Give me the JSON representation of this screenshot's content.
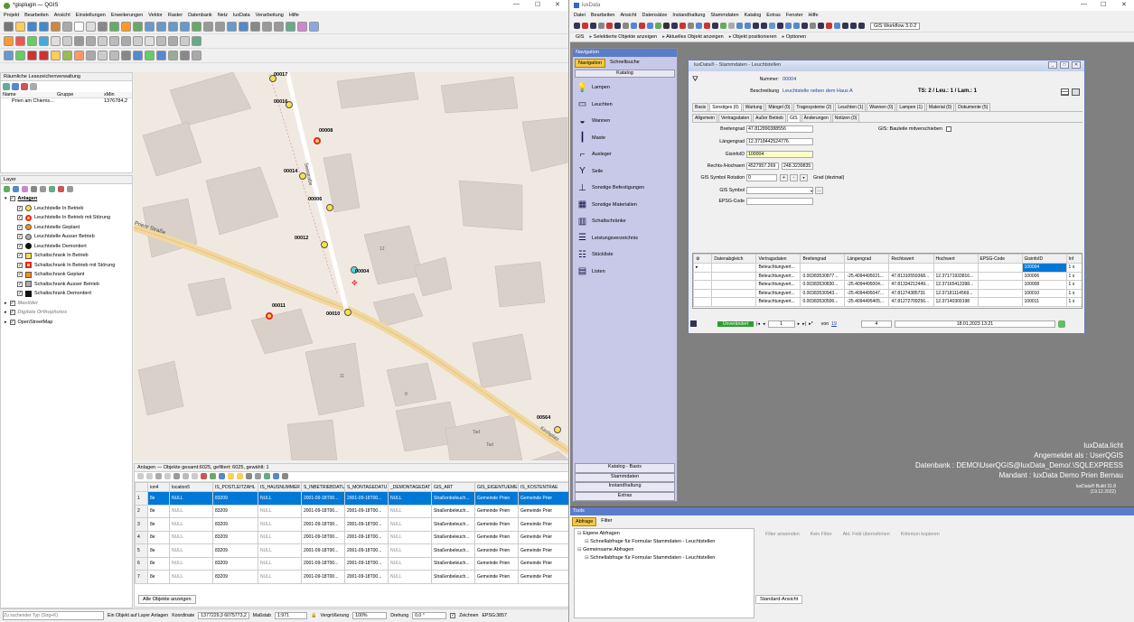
{
  "qgis": {
    "title": "*gisplugin — QGIS",
    "menu": [
      "Projekt",
      "Bearbeiten",
      "Ansicht",
      "Einstellungen",
      "Erweiterungen",
      "Vektor",
      "Raster",
      "Datenbank",
      "Netz",
      "luxData",
      "Verarbeitung",
      "Hilfe"
    ],
    "bookmarks": {
      "title": "Räumliche Lesezeichenverwaltung",
      "cols": [
        "Name",
        "Gruppe",
        "xMin"
      ],
      "row": {
        "name": "Prien am Chiems...",
        "group": "",
        "xmin": "1376784,2"
      }
    },
    "layers_title": "Layer",
    "layers": [
      {
        "label": "Anlagen",
        "group": true
      },
      {
        "label": "Leuchtstelle In Betrieb",
        "sym": "yellow-circle"
      },
      {
        "label": "Leuchtstelle In Betrieb mit Störung",
        "sym": "red-ring"
      },
      {
        "label": "Leuchtstelle Geplant",
        "sym": "orange-circle"
      },
      {
        "label": "Leuchtstelle Ausser Betrieb",
        "sym": "gray-circle"
      },
      {
        "label": "Leuchtstelle Demontiert",
        "sym": "black-circle"
      },
      {
        "label": "Schaltschrank In Betrieb",
        "sym": "yellow-square"
      },
      {
        "label": "Schaltschrank In Betrieb mit Störung",
        "sym": "red-square"
      },
      {
        "label": "Schaltschrank Geplant",
        "sym": "orange-square"
      },
      {
        "label": "Schaltschrank Ausser Betrieb",
        "sym": "gray-square"
      },
      {
        "label": "Schaltschrank Demontiert",
        "sym": "black-square"
      },
      {
        "label": "Mastlder",
        "group": true,
        "italic": true
      },
      {
        "label": "Digitale Orthophotos",
        "group": true,
        "italic": true
      },
      {
        "label": "OpenStreetMap",
        "group": true
      }
    ],
    "map_labels": [
      {
        "text": "00017"
      },
      {
        "text": "00016"
      },
      {
        "text": "00008"
      },
      {
        "text": "00014"
      },
      {
        "text": "00006"
      },
      {
        "text": "00012"
      },
      {
        "text": "00004"
      },
      {
        "text": "00011"
      },
      {
        "text": "00010"
      },
      {
        "text": "00564"
      }
    ],
    "street_labels": [
      "Prienr Straße",
      "Seestraße",
      "Kirchplatz"
    ],
    "house_numbers": [
      "12",
      "11",
      "9",
      "Tad",
      "Tad"
    ],
    "attr": {
      "title": "Anlagen — Objekte gesamt:6025, gefiltert: 6025, gewählt: 1",
      "cols": [
        "ion4",
        "location5",
        "IS_POSTLEITZAHL",
        "IS_HAUSNUMMER",
        "S_INBETRIEBDATU",
        "S_MONTAGEDATU",
        "_DEMONTAGEDAT",
        "GIS_ART",
        "GIS_EIGENTUEMER",
        "IS_KOSTENTRAE"
      ],
      "rows": [
        [
          "1",
          "8e",
          "NULL",
          "83209",
          "NULL",
          "2001-09-18T00...",
          "2001-09-18T00...",
          "NULL",
          "Straßenbeleuch...",
          "Gemeinde Prien",
          "Gemeinde Prier"
        ],
        [
          "2",
          "8e",
          "NULL",
          "83209",
          "NULL",
          "2001-09-18T00...",
          "2001-09-18T00...",
          "NULL",
          "Straßenbeleuch...",
          "Gemeinde Prien",
          "Gemeinde Prier"
        ],
        [
          "3",
          "8e",
          "NULL",
          "83209",
          "NULL",
          "2001-09-18T00...",
          "2001-09-18T00...",
          "NULL",
          "Straßenbeleuch...",
          "Gemeinde Prien",
          "Gemeinde Prier"
        ],
        [
          "4",
          "8e",
          "NULL",
          "83209",
          "NULL",
          "2001-09-18T00...",
          "2001-09-18T00...",
          "NULL",
          "Straßenbeleuch...",
          "Gemeinde Prien",
          "Gemeinde Prier"
        ],
        [
          "5",
          "8e",
          "NULL",
          "83209",
          "NULL",
          "2001-09-18T00...",
          "2001-09-18T00...",
          "NULL",
          "Straßenbeleuch...",
          "Gemeinde Prien",
          "Gemeinde Prier"
        ],
        [
          "6",
          "8e",
          "NULL",
          "83209",
          "NULL",
          "2001-09-18T00...",
          "2001-09-18T00...",
          "NULL",
          "Straßenbeleuch...",
          "Gemeinde Prien",
          "Gemeinde Prier"
        ],
        [
          "7",
          "8e",
          "NULL",
          "83209",
          "NULL",
          "2001-09-18T00...",
          "2001-09-18T00...",
          "NULL",
          "Straßenbeleuch...",
          "Gemeinde Prien",
          "Gemeinde Prier"
        ]
      ],
      "show_all": "Alle Objekte anzeigen"
    },
    "status": {
      "search_placeholder": "Zu suchender Typ (Strg+K)",
      "msg": "Ein Objekt auf Layer Anlagen",
      "coord_label": "Koordinate",
      "coord": "1377229,3 6075773,2",
      "scale_label": "Maßstab",
      "scale": "1:971",
      "magnifier_label": "Vergrößerung",
      "magnifier": "100%",
      "rotation_label": "Drehung",
      "rotation": "0,0 °",
      "render_label": "Zeichnen",
      "crs": "EPSG:3857"
    }
  },
  "lux": {
    "title": "luxData",
    "menu": [
      "Datei",
      "Bearbeiten",
      "Ansicht",
      "Datensätze",
      "Instandhaltung",
      "Stammdaten",
      "Katalog",
      "Extras",
      "Fenster",
      "Hilfe"
    ],
    "gis_workflow": "GIS Workflow 3.0.2",
    "gisbar": [
      "GIS",
      "Selektierte Objekte anzeigen",
      "Aktuelles Objekt anzeigen",
      "Objekt positionieren",
      "Optionen"
    ],
    "nav": {
      "title": "Navigation",
      "tabs": [
        "Navigation",
        "Schnellsuche"
      ],
      "katalog": "Katalog",
      "items": [
        "Lampen",
        "Leuchten",
        "Wannen",
        "Maste",
        "Ausleger",
        "Seile",
        "Sonstige Befestigungen",
        "Sonstige Materialien",
        "Schaltschränke",
        "Leistungsverzeichnis",
        "Stückliste",
        "Listen"
      ],
      "bottom": [
        "Katalog - Basis",
        "Stammdaten",
        "Instandhaltung",
        "Extras"
      ]
    },
    "form": {
      "title": "luxData® - Stammdaten - Leuchtstellen",
      "nummer_label": "Nummer:",
      "nummer": "00004",
      "beschreibung_label": "Beschreibung",
      "beschreibung": "Leuchtstelle neben dem Haus A",
      "ts": "TS: 2 / Leu.: 1 / Lam.: 1",
      "tabs": [
        "Basis",
        "Sonstiges (0)",
        "Wartung",
        "Mängel (0)",
        "Tragesysteme (2)",
        "Leuchten (1)",
        "Wannen (0)",
        "Lampen (1)",
        "Material (0)",
        "Dokumente (5)"
      ],
      "subtabs": [
        "Allgemein",
        "Vertragsdaten",
        "Außer Betrieb",
        "GIS",
        "Änderungen",
        "Notizen (0)"
      ],
      "breitengrad_label": "Breitengrad",
      "breitengrad": "47.812890388556",
      "laengengrad_label": "Längengrad",
      "laengengrad": "12.3718442524776",
      "gisinfoid_label": "GisinfoID",
      "gisinfoid": "100004",
      "rh_label": "Rechts-/Hochwert",
      "rechtswert": "4527957.269",
      "hochwert": "248.3239835",
      "rot_label": "GIS Symbol Rotation",
      "rot": "0",
      "grad": "Grad (dezimal)",
      "symbol_label": "GIS Symbol",
      "epsg_label": "EPSG-Code",
      "mitverschieben": "GIS: Bauteile mitverschieben",
      "grid_cols": [
        "Datenabgleich",
        "Vertragsdaten",
        "Breitengrad",
        "Längengrad",
        "Rechtswert",
        "Hochwert",
        "EPSG-Code",
        "GisinfoID",
        "Inf"
      ],
      "grid_rows": [
        [
          "",
          "Beleuchtungvert...",
          "",
          "",
          "",
          "",
          "",
          "100004",
          "1 x"
        ],
        [
          "",
          "Beleuchtungvert...",
          "0.00383530877...",
          "-25.4094495021...",
          "47.81310559368...",
          "12.37171933816...",
          "",
          "100006",
          "1 x"
        ],
        [
          "",
          "Beleuchtungvert...",
          "0.00383530830...",
          "-25.4094495004...",
          "47.81334212449...",
          "12.37165413398...",
          "",
          "100008",
          "1 x"
        ],
        [
          "",
          "Beleuchtungvert...",
          "0.00383530943...",
          "-25.4094495047...",
          "47.81274385731",
          "12.37181114569...",
          "",
          "100010",
          "1 x"
        ],
        [
          "",
          "Beleuchtungvert...",
          "0.00383530506...",
          "-25.4094495405...",
          "47.81272709256...",
          "12.37140309198",
          "",
          "100011",
          "1 x"
        ]
      ],
      "status_btn": "Unverändert",
      "page": "1",
      "von": "von",
      "total": "19",
      "count": "4",
      "date": "18.01.2023 13:21"
    },
    "info": {
      "line1": "luxData.licht",
      "line2": "Angemeldet als : UserQGIS",
      "line3": "Datenbank : DEMO\\UserQGIS@luxData_Demo/.\\SQLEXPRESS",
      "line4": "Mandant : luxData Demo Prien Bernau",
      "build": "luxData® Build 31.8",
      "build_date": "(19.12.2022)"
    },
    "tools": {
      "title": "Tools",
      "tabs": [
        "Abfrage",
        "Filter"
      ],
      "tree": [
        "Eigene Abfragen",
        "Schnellabfrage für Formular Stammdaten - Leuchtstellen",
        "Gemeinsame Abfragen",
        "Schnellabfrage für Formular Stammdaten - Leuchtstellen"
      ],
      "actions": [
        "Filter anwenden",
        "Kein Filter",
        "Akt. Feld übernehmen",
        "Kriterium kopieren"
      ],
      "view": "Standard-Ansicht"
    }
  },
  "colors": {
    "lux_bg": "#808080",
    "lux_nav": "#c8c8e8",
    "selection": "#0078d7",
    "status_green": "#2e9e2e"
  }
}
